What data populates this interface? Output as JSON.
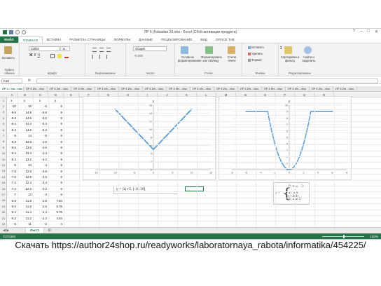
{
  "window": {
    "title": "ЛР 4 (Indzadan 10.xlsx - Excel (Сбой активации продукта)",
    "controls": [
      "?",
      "–",
      "□",
      "✕"
    ]
  },
  "ribbon_tabs": [
    "ФАЙЛ",
    "ГЛАВНАЯ",
    "ВСТАВКА",
    "РАЗМЕТКА СТРАНИЦЫ",
    "ФОРМУЛЫ",
    "ДАННЫЕ",
    "РЕЦЕНЗИРОВАНИЕ",
    "ВИД",
    "OFFICE TAB"
  ],
  "ribbon": {
    "paste": "Вставить",
    "clipboard": "Буфер обмена",
    "font_name": "Calibri",
    "font_size": "11",
    "font": "Шрифт",
    "alignment": "Выравнивание",
    "number_format": "Общий",
    "number": "Число",
    "conditional": "Условное форматирование",
    "as_table": "Форматировать как таблицу",
    "cell_styles": "Стили ячеек",
    "styles": "Стили",
    "insert": "Вставить",
    "delete": "Удалить",
    "format": "Формат",
    "cells": "Ячейки",
    "sort": "Сортировка и фильтр",
    "find": "Найти и выделить",
    "editing": "Редактирование"
  },
  "formula_bar": {
    "name_box": "K19",
    "fx": "fx",
    "value": ""
  },
  "sheet_tabs": [
    "ЛР 4 - Ins...xlsx",
    "ЛР 4 Ин....xlsx",
    "ЛР 4 Ин....xlsx",
    "ЛР 4 Ин....xlsx",
    "ЛР 4 Ин....xlsx",
    "ЛР 4 Ин....xlsx",
    "ЛР 4 Ин....xlsx",
    "ЛР 4 Ин....xlsx",
    "ЛР 4 Ин....xlsx",
    "ЛР 4 Ин....xlsx",
    "ЛР 4 Ин....xlsx",
    "ЛР 4 Ин....xlsx",
    "ЛР 4 Ин....xlsx",
    "ЛР 4 Ин....xlsx",
    "ЛР 4 Ин....xlsx"
  ],
  "columns": [
    "A",
    "B",
    "C",
    "D",
    "E",
    "F",
    "G",
    "H",
    "I",
    "J",
    "K",
    "L",
    "M",
    "N",
    "O",
    "P",
    "Q",
    "R"
  ],
  "rows": [
    {
      "n": "1",
      "a": "x",
      "b": "y",
      "c": "x",
      "d": "y"
    },
    {
      "n": "2",
      "a": "-10",
      "b": "15",
      "c": "-6",
      "d": "9"
    },
    {
      "n": "3",
      "a": "-9.8",
      "b": "14.8",
      "c": "-5.8",
      "d": "9"
    },
    {
      "n": "4",
      "a": "-9.6",
      "b": "14.6",
      "c": "-5.6",
      "d": "9"
    },
    {
      "n": "5",
      "a": "-9.4",
      "b": "14.4",
      "c": "-5.4",
      "d": "9"
    },
    {
      "n": "6",
      "a": "-9.2",
      "b": "14.2",
      "c": "-5.2",
      "d": "9"
    },
    {
      "n": "7",
      "a": "-9",
      "b": "14",
      "c": "-5",
      "d": "9"
    },
    {
      "n": "8",
      "a": "-8.8",
      "b": "13.8",
      "c": "-4.8",
      "d": "9"
    },
    {
      "n": "9",
      "a": "-8.6",
      "b": "13.6",
      "c": "-4.6",
      "d": "9"
    },
    {
      "n": "10",
      "a": "-8.4",
      "b": "13.4",
      "c": "-4.4",
      "d": "9"
    },
    {
      "n": "11",
      "a": "-8.2",
      "b": "13.2",
      "c": "-4.2",
      "d": "9"
    },
    {
      "n": "12",
      "a": "-8",
      "b": "13",
      "c": "-4",
      "d": "9"
    },
    {
      "n": "13",
      "a": "-7.8",
      "b": "12.8",
      "c": "-3.8",
      "d": "9"
    },
    {
      "n": "14",
      "a": "-7.6",
      "b": "12.6",
      "c": "-3.6",
      "d": "9"
    },
    {
      "n": "15",
      "a": "-7.4",
      "b": "12.4",
      "c": "-3.4",
      "d": "9"
    },
    {
      "n": "16",
      "a": "-7.2",
      "b": "12.2",
      "c": "-3.2",
      "d": "9"
    },
    {
      "n": "17",
      "a": "-7",
      "b": "12",
      "c": "-3",
      "d": "9"
    },
    {
      "n": "18",
      "a": "-6.8",
      "b": "11.8",
      "c": "-2.8",
      "d": "7.84"
    },
    {
      "n": "19",
      "a": "-6.6",
      "b": "11.6",
      "c": "-2.6",
      "d": "6.76"
    },
    {
      "n": "20",
      "a": "-6.4",
      "b": "11.4",
      "c": "-2.4",
      "d": "5.76"
    },
    {
      "n": "21",
      "a": "-6.2",
      "b": "11.2",
      "c": "-2.2",
      "d": "4.84"
    },
    {
      "n": "22",
      "a": "-6",
      "b": "11",
      "c": "-2",
      "d": "4"
    }
  ],
  "formulas": {
    "f1": "y = |x|+5, [-10;10],",
    "f2_y": "y =",
    "f2_lines": [
      "9, x ≤ −3",
      "x², x ∈ (−3;3)",
      "9, x ≥ 3"
    ]
  },
  "chart1": {
    "title": "y",
    "xlim": [
      -15,
      15
    ],
    "ylim": [
      0,
      16
    ],
    "xticks": [
      "-15",
      "-10",
      "-5",
      "0",
      "5",
      "10",
      "15"
    ],
    "yticks": [
      "0",
      "2",
      "4",
      "6",
      "8",
      "10",
      "12",
      "14",
      "16"
    ],
    "color": "#5b9bd5"
  },
  "chart2": {
    "title": "y",
    "xlim": [
      -8,
      8
    ],
    "ylim": [
      0,
      10
    ],
    "xticks": [
      "-8",
      "-6",
      "-4",
      "-2",
      "0",
      "2",
      "4",
      "6",
      "8"
    ],
    "yticks": [
      "0",
      "1",
      "2",
      "3",
      "4",
      "5",
      "6",
      "7",
      "8",
      "9",
      "10"
    ],
    "color": "#5b9bd5"
  },
  "chart_data": [
    {
      "type": "line",
      "title": "y",
      "x": [
        -10,
        0,
        10
      ],
      "series": [
        {
          "values": [
            15,
            5,
            15
          ]
        }
      ],
      "xlim": [
        -15,
        15
      ],
      "ylim": [
        0,
        16
      ],
      "grid": true
    },
    {
      "type": "scatter",
      "title": "y",
      "x": [
        -6,
        -5,
        -4,
        -3,
        -2,
        -1,
        0,
        1,
        2,
        3,
        4,
        5,
        6
      ],
      "series": [
        {
          "values": [
            9,
            9,
            9,
            9,
            4,
            1,
            0,
            1,
            4,
            9,
            9,
            9,
            9
          ]
        }
      ],
      "xlim": [
        -8,
        8
      ],
      "ylim": [
        0,
        10
      ],
      "grid": true
    }
  ],
  "bottom": {
    "sheet": "Лист1",
    "add": "⊕"
  },
  "status": {
    "ready": "ГОТОВО",
    "zoom": "100%"
  },
  "caption": "Скачать https://author24shop.ru/readyworks/laboratornaya_rabota/informatika/454225/"
}
